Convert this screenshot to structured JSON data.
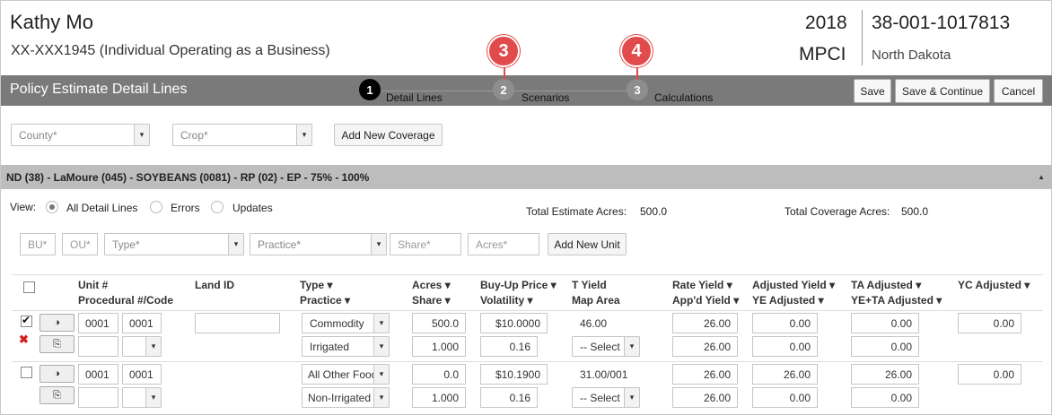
{
  "customer": {
    "name": "Kathy Mo",
    "id_line": "XX-XXX1945 (Individual Operating as a Business)"
  },
  "policy": {
    "year": "2018",
    "type": "MPCI",
    "number": "38-001-1017813",
    "state": "North Dakota"
  },
  "callouts": [
    "3",
    "4"
  ],
  "title_bar": {
    "title": "Policy Estimate Detail Lines",
    "steps": [
      {
        "num": "1",
        "label": "Detail Lines"
      },
      {
        "num": "2",
        "label": "Scenarios"
      },
      {
        "num": "3",
        "label": "Calculations"
      }
    ],
    "buttons": {
      "save": "Save",
      "save_continue": "Save & Continue",
      "cancel": "Cancel"
    }
  },
  "coverage_filters": {
    "county_placeholder": "County*",
    "crop_placeholder": "Crop*",
    "add_coverage": "Add New Coverage"
  },
  "coverage": {
    "title": "ND (38) - LaMoure (045) - SOYBEANS (0081) - RP (02) - EP - 75% - 100%",
    "view_label": "View:",
    "view_options": [
      "All Detail Lines",
      "Errors",
      "Updates"
    ],
    "total_estimate_label": "Total Estimate Acres:",
    "total_estimate_value": "500.0",
    "total_coverage_label": "Total Coverage Acres:",
    "total_coverage_value": "500.0"
  },
  "unit_filters": {
    "bu": "BU*",
    "ou": "OU*",
    "type": "Type*",
    "practice": "Practice*",
    "share": "Share*",
    "acres": "Acres*",
    "add_unit": "Add New Unit"
  },
  "columns": {
    "unit": "Unit #",
    "procedural": "Procedural #/Code",
    "land_id": "Land ID",
    "type": "Type ▾",
    "practice": "Practice ▾",
    "acres": "Acres ▾",
    "share": "Share ▾",
    "buyup": "Buy-Up Price ▾",
    "volatility": "Volatility ▾",
    "tyield": "T Yield",
    "map_area": "Map Area",
    "rate_yield": "Rate Yield ▾",
    "appd_yield": "App'd Yield ▾",
    "adj_yield": "Adjusted Yield ▾",
    "ye_adjusted": "YE Adjusted ▾",
    "ta_adjusted": "TA Adjusted ▾",
    "ye_ta_adjusted": "YE+TA Adjusted ▾",
    "yc_adjusted": "YC Adjusted ▾"
  },
  "rows": [
    {
      "checked": true,
      "unit": "0001",
      "unit2": "0001",
      "type": "Commodity",
      "practice": "Irrigated",
      "acres": "500.0",
      "share": "1.000",
      "buyup": "$10.0000",
      "volatility": "0.16",
      "tyield": "46.00",
      "map_area": "-- Select",
      "rate_yield": "26.00",
      "appd_yield": "26.00",
      "adj_yield": "0.00",
      "ye_adjusted": "0.00",
      "ta_adjusted": "0.00",
      "ye_ta_adjusted": "0.00",
      "yc_adjusted": "0.00",
      "delete": "✖"
    },
    {
      "checked": false,
      "unit": "0001",
      "unit2": "0001",
      "type": "All Other Food",
      "practice": "Non-Irrigated",
      "acres": "0.0",
      "share": "1.000",
      "buyup": "$10.1900",
      "volatility": "0.16",
      "tyield": "31.00/001",
      "map_area": "-- Select",
      "rate_yield": "26.00",
      "appd_yield": "26.00",
      "adj_yield": "26.00",
      "ye_adjusted": "0.00",
      "ta_adjusted": "26.00",
      "ye_ta_adjusted": "0.00",
      "yc_adjusted": "0.00"
    }
  ],
  "icons": {
    "contrast": "◑",
    "copy": "⎘",
    "chevron": "▾",
    "collapse": "▲"
  }
}
